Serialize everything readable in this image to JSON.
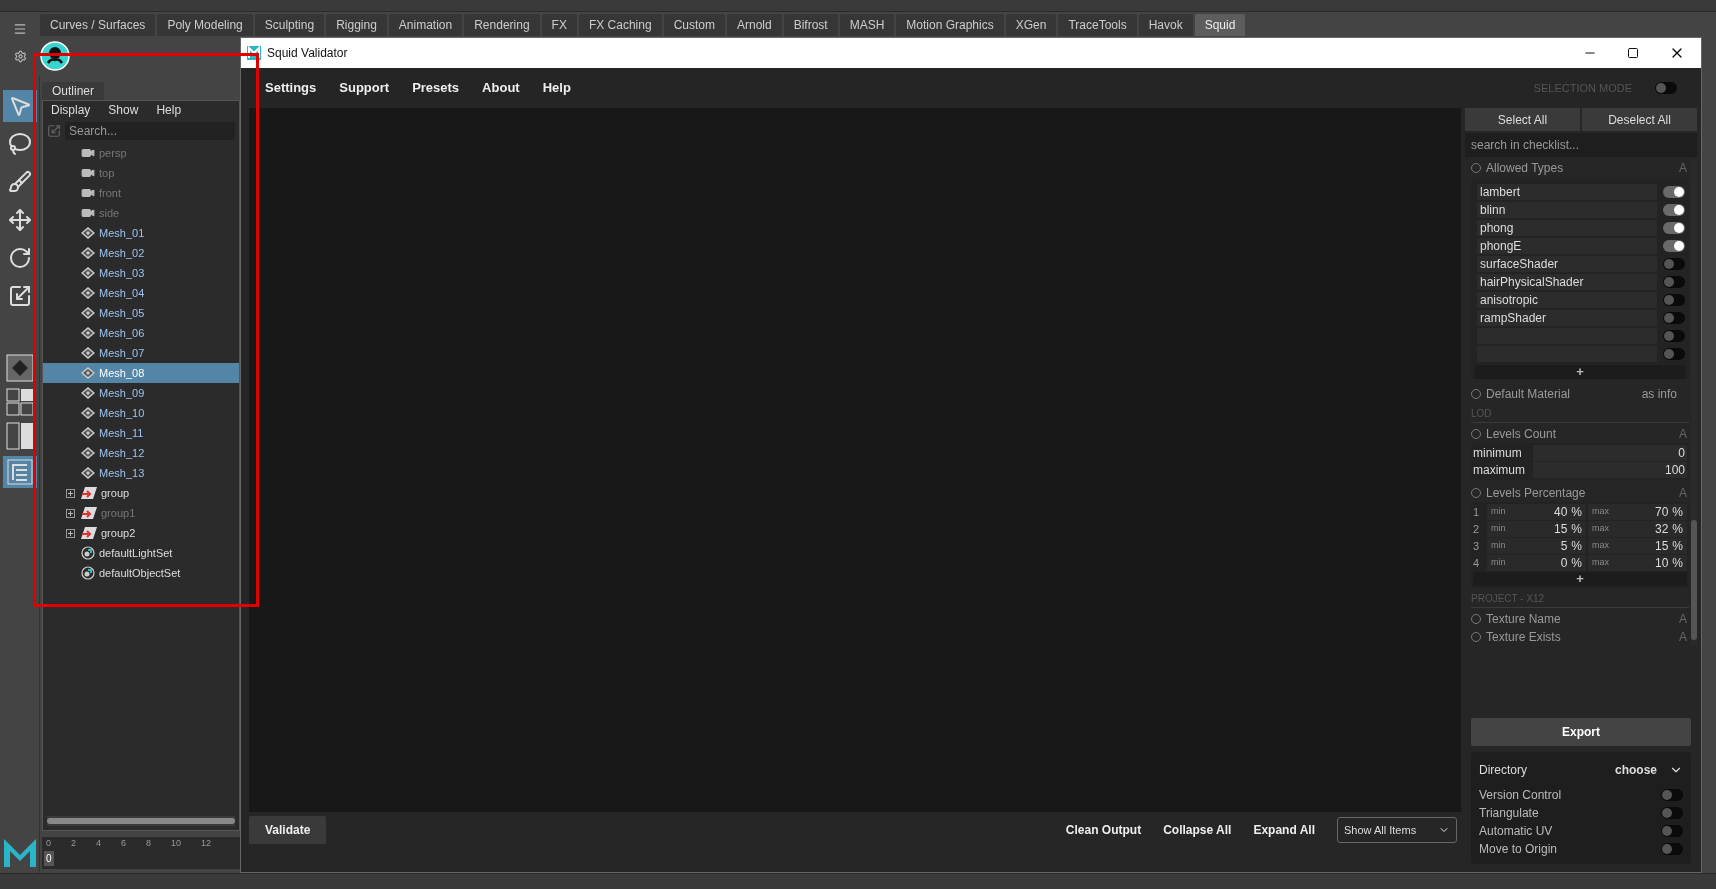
{
  "shelf_tabs": [
    {
      "label": "Curves / Surfaces",
      "selected": false
    },
    {
      "label": "Poly Modeling",
      "selected": false
    },
    {
      "label": "Sculpting",
      "selected": false
    },
    {
      "label": "Rigging",
      "selected": false
    },
    {
      "label": "Animation",
      "selected": false
    },
    {
      "label": "Rendering",
      "selected": false
    },
    {
      "label": "FX",
      "selected": false
    },
    {
      "label": "FX Caching",
      "selected": false
    },
    {
      "label": "Custom",
      "selected": false
    },
    {
      "label": "Arnold",
      "selected": false
    },
    {
      "label": "Bifrost",
      "selected": false
    },
    {
      "label": "MASH",
      "selected": false
    },
    {
      "label": "Motion Graphics",
      "selected": false
    },
    {
      "label": "XGen",
      "selected": false
    },
    {
      "label": "TraceTools",
      "selected": false
    },
    {
      "label": "Havok",
      "selected": false
    },
    {
      "label": "Squid",
      "selected": true
    }
  ],
  "outliner": {
    "title": "Outliner",
    "menu": [
      "Display",
      "Show",
      "Help"
    ],
    "search": {
      "placeholder": "Search..."
    },
    "items": [
      {
        "kind": "camera",
        "label": "persp",
        "dimmed": true,
        "selected": false
      },
      {
        "kind": "camera",
        "label": "top",
        "dimmed": true,
        "selected": false
      },
      {
        "kind": "camera",
        "label": "front",
        "dimmed": true,
        "selected": false
      },
      {
        "kind": "camera",
        "label": "side",
        "dimmed": true,
        "selected": false
      },
      {
        "kind": "mesh",
        "label": "Mesh_01",
        "dimmed": false,
        "selected": false
      },
      {
        "kind": "mesh",
        "label": "Mesh_02",
        "dimmed": false,
        "selected": false
      },
      {
        "kind": "mesh",
        "label": "Mesh_03",
        "dimmed": false,
        "selected": false
      },
      {
        "kind": "mesh",
        "label": "Mesh_04",
        "dimmed": false,
        "selected": false
      },
      {
        "kind": "mesh",
        "label": "Mesh_05",
        "dimmed": false,
        "selected": false
      },
      {
        "kind": "mesh",
        "label": "Mesh_06",
        "dimmed": false,
        "selected": false
      },
      {
        "kind": "mesh",
        "label": "Mesh_07",
        "dimmed": false,
        "selected": false
      },
      {
        "kind": "mesh",
        "label": "Mesh_08",
        "dimmed": false,
        "selected": true
      },
      {
        "kind": "mesh",
        "label": "Mesh_09",
        "dimmed": false,
        "selected": false
      },
      {
        "kind": "mesh",
        "label": "Mesh_10",
        "dimmed": false,
        "selected": false
      },
      {
        "kind": "mesh",
        "label": "Mesh_11",
        "dimmed": false,
        "selected": false
      },
      {
        "kind": "mesh",
        "label": "Mesh_12",
        "dimmed": false,
        "selected": false
      },
      {
        "kind": "mesh",
        "label": "Mesh_13",
        "dimmed": false,
        "selected": false
      },
      {
        "kind": "group",
        "label": "group",
        "dimmed": false,
        "selected": false,
        "expanded": false
      },
      {
        "kind": "group",
        "label": "group1",
        "dimmed": true,
        "selected": false,
        "expanded": false
      },
      {
        "kind": "group",
        "label": "group2",
        "dimmed": false,
        "selected": false,
        "expanded": false
      },
      {
        "kind": "set",
        "label": "defaultLightSet",
        "dimmed": false,
        "selected": false
      },
      {
        "kind": "set",
        "label": "defaultObjectSet",
        "dimmed": false,
        "selected": false
      }
    ]
  },
  "timeline": {
    "current": "0",
    "ticks": [
      "0",
      "2",
      "4",
      "6",
      "8",
      "10",
      "12"
    ]
  },
  "window": {
    "title": "Squid Validator",
    "menu": [
      "Settings",
      "Support",
      "Presets",
      "About",
      "Help"
    ],
    "selection_mode": {
      "label": "SELECTION MODE",
      "on": false
    },
    "checklist": {
      "buttons": [
        "Select All",
        "Deselect All"
      ],
      "search": {
        "placeholder": "search in checklist..."
      },
      "sections": [
        {
          "kind": "check",
          "label": "Allowed Types",
          "badge": "A"
        },
        {
          "kind": "types",
          "add": "+",
          "items": [
            {
              "label": "lambert",
              "on": true
            },
            {
              "label": "blinn",
              "on": true
            },
            {
              "label": "phong",
              "on": true
            },
            {
              "label": "phongE",
              "on": true
            },
            {
              "label": "surfaceShader",
              "on": false
            },
            {
              "label": "hairPhysicalShader",
              "on": false
            },
            {
              "label": "anisotropic",
              "on": false
            },
            {
              "label": "rampShader",
              "on": false
            },
            {
              "on": false
            },
            {
              "on": false
            }
          ]
        },
        {
          "kind": "check",
          "label": "Default Material",
          "note": "as info"
        },
        {
          "kind": "heading",
          "label": "LOD"
        },
        {
          "kind": "check",
          "label": "Levels Count",
          "badge": "A"
        },
        {
          "kind": "range",
          "rows": [
            {
              "label": "minimum",
              "value": "0"
            },
            {
              "label": "maximum",
              "value": "100"
            }
          ]
        },
        {
          "kind": "check",
          "label": "Levels Percentage",
          "badge": "A"
        },
        {
          "kind": "percentages",
          "add": "+",
          "rows": [
            {
              "index": "1",
              "min_label": "min",
              "min": "40",
              "min_unit": "%",
              "max_label": "max",
              "max": "70",
              "max_unit": "%"
            },
            {
              "index": "2",
              "min_label": "min",
              "min": "15",
              "min_unit": "%",
              "max_label": "max",
              "max": "32",
              "max_unit": "%"
            },
            {
              "index": "3",
              "min_label": "min",
              "min": "5",
              "min_unit": "%",
              "max_label": "max",
              "max": "15",
              "max_unit": "%"
            },
            {
              "index": "4",
              "min_label": "min",
              "min": "0",
              "min_unit": "%",
              "max_label": "max",
              "max": "10",
              "max_unit": "%"
            }
          ]
        },
        {
          "kind": "heading",
          "label": "PROJECT - X12"
        },
        {
          "kind": "check",
          "label": "Texture Name",
          "badge": "A"
        },
        {
          "kind": "check",
          "label": "Texture Exists",
          "badge": "A"
        }
      ]
    },
    "export": {
      "button": "Export",
      "directory_label": "Directory",
      "directory_value": "choose",
      "toggles": [
        {
          "label": "Version Control",
          "on": false
        },
        {
          "label": "Triangulate",
          "on": false
        },
        {
          "label": "Automatic UV",
          "on": false
        },
        {
          "label": "Move to Origin",
          "on": false
        }
      ]
    },
    "bottom": {
      "validate": "Validate",
      "actions": [
        "Clean Output",
        "Collapse All",
        "Expand All"
      ],
      "filter": "Show All Items"
    }
  }
}
